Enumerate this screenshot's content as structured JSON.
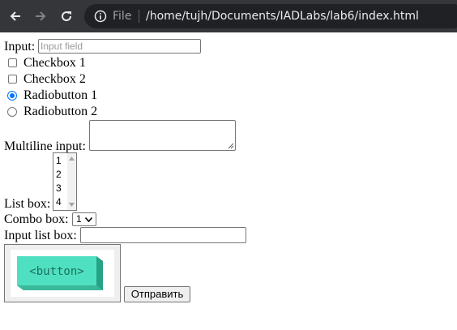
{
  "browser": {
    "scheme": "File",
    "url": "/home/tujh/Documents/IADLabs/lab6/index.html"
  },
  "form": {
    "input_label": "Input:",
    "input_placeholder": "Input field",
    "checkbox1_label": "Checkbox 1",
    "checkbox1_checked": false,
    "checkbox2_label": "Checkbox 2",
    "checkbox2_checked": false,
    "radio1_label": "Radiobutton 1",
    "radio1_checked": true,
    "radio2_label": "Radiobutton 2",
    "radio2_checked": false,
    "multiline_label": "Multiline input:",
    "listbox_label": "List box:",
    "listbox_options": [
      "1",
      "2",
      "3",
      "4"
    ],
    "combo_label": "Combo box:",
    "combo_value": "1",
    "input_list_label": "Input list box:",
    "image_button_text": "<button>",
    "submit_label": "Отправить"
  },
  "colors": {
    "chrome_bg": "#35363a",
    "omnibox_bg": "#202124",
    "radio_accent": "#0075ff",
    "image_button_face": "#4ee0c0"
  }
}
